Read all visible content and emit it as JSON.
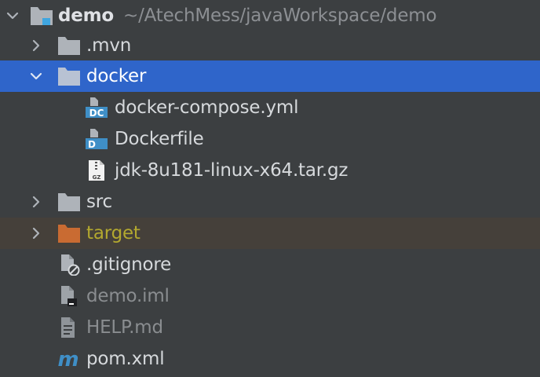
{
  "root": {
    "name": "demo",
    "path": "~/AtechMess/javaWorkspace/demo"
  },
  "items": [
    {
      "label": ".mvn",
      "kind": "folder"
    },
    {
      "label": "docker",
      "kind": "folder",
      "state": "selected"
    },
    {
      "label": "docker-compose.yml",
      "kind": "docker-compose-file",
      "badge": "DC"
    },
    {
      "label": "Dockerfile",
      "kind": "dockerfile",
      "badge": "D"
    },
    {
      "label": "jdk-8u181-linux-x64.tar.gz",
      "kind": "archive-file",
      "badge": "GZ"
    },
    {
      "label": "src",
      "kind": "folder"
    },
    {
      "label": "target",
      "kind": "folder",
      "state": "excluded"
    },
    {
      "label": ".gitignore",
      "kind": "ignored-file"
    },
    {
      "label": "demo.iml",
      "kind": "module-file"
    },
    {
      "label": "HELP.md",
      "kind": "markdown-file"
    },
    {
      "label": "pom.xml",
      "kind": "maven-file",
      "badge": "m"
    }
  ],
  "colors": {
    "background": "#3c3f41",
    "selection": "#2f65ca",
    "excluded_row": "#45403a",
    "excluded_text": "#b3a82f",
    "folder": "#aeb3b9",
    "excluded_folder": "#c96b32",
    "docker_blue": "#3f8fc7"
  }
}
